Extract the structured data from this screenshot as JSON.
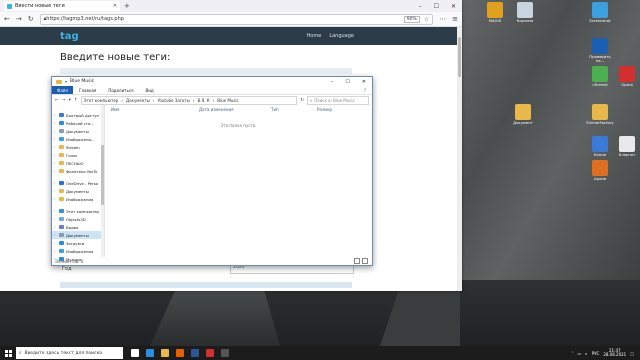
{
  "browser": {
    "tab_title": "Ввести новые теги",
    "url": "https://tagmp3.net/ru/tags.php",
    "zoom": "90%",
    "site_logo": "tag",
    "site_nav": [
      "Home",
      "Language"
    ],
    "page_title": "Введите новые теги:",
    "form_label": "Год",
    "form_value": "2020"
  },
  "explorer": {
    "title": "Blue Music",
    "ribbon": [
      "Файл",
      "Главная",
      "Поделиться",
      "Вид"
    ],
    "breadcrumb": [
      "Этот компьютер",
      "Документы",
      "Youtube Заготы",
      "В.Я. К",
      "Blue Music"
    ],
    "search_placeholder": "Поиск в: Blue Music",
    "nav_items": [
      {
        "label": "Быстрый доступ",
        "icon": "star-icon",
        "color": "#3a7bd5"
      },
      {
        "label": "Рабочий сто...",
        "icon": "desktop-icon",
        "color": "#2a8ee0"
      },
      {
        "label": "Документы",
        "icon": "documents-icon",
        "color": "#8a9bb0"
      },
      {
        "label": "Изображени...",
        "icon": "pictures-icon",
        "color": "#3aa0e0"
      },
      {
        "label": "Stream",
        "icon": "folder-icon",
        "color": "#e8b948"
      },
      {
        "label": "Голос",
        "icon": "folder-icon",
        "color": "#e8b948"
      },
      {
        "label": "ПЕСНЬЮ",
        "icon": "folder-icon",
        "color": "#e8b948"
      },
      {
        "label": "Фонотека YouTu",
        "icon": "folder-icon",
        "color": "#e8b948"
      },
      {
        "label": "OneDrive - Perso",
        "icon": "cloud-icon",
        "color": "#1a73e8"
      },
      {
        "label": "Документы",
        "icon": "folder-icon",
        "color": "#e8b948"
      },
      {
        "label": "Изображения",
        "icon": "folder-icon",
        "color": "#e8b948"
      },
      {
        "label": "Этот компьютер",
        "icon": "computer-icon",
        "color": "#3a8fd8"
      },
      {
        "label": "Objects3D",
        "icon": "objects3d-icon",
        "color": "#7aa6d8"
      },
      {
        "label": "Видео",
        "icon": "video-icon",
        "color": "#6b7bd8"
      },
      {
        "label": "Документы",
        "icon": "documents-icon",
        "color": "#8a9bb0"
      },
      {
        "label": "Загрузки",
        "icon": "downloads-icon",
        "color": "#2a8ee0"
      },
      {
        "label": "Изображения",
        "icon": "pictures-icon",
        "color": "#3aa0e0"
      },
      {
        "label": "Музыка",
        "icon": "music-icon",
        "color": "#2a8ee0"
      }
    ],
    "selected_nav_index": 14,
    "columns": [
      "Имя",
      "Дата изменения",
      "Тип",
      "Размер"
    ],
    "empty_text": "Эта папка пуста.",
    "status": "Элементов: 0"
  },
  "desktop_icons": [
    {
      "label": "MAGIX",
      "color": "#e0a020"
    },
    {
      "label": "Корзина",
      "color": "#c8d4e0"
    },
    {
      "label": "Screenshot",
      "color": "#3aa0e0"
    },
    {
      "label": "Проверить на...",
      "color": "#1a5fb4"
    },
    {
      "label": "uTorrent",
      "color": "#4caf50"
    },
    {
      "label": "Opera",
      "color": "#d32f2f"
    },
    {
      "label": "Документ",
      "color": "#e8b948"
    },
    {
      "label": "FormatFactory",
      "color": "#e8b948"
    },
    {
      "label": "Копия",
      "color": "#3a7bd5"
    },
    {
      "label": "Блокнот",
      "color": "#e8e8e8"
    },
    {
      "label": "Архив",
      "color": "#e07020"
    }
  ],
  "taskbar": {
    "search_placeholder": "Введите здесь текст для поиска",
    "icons": [
      {
        "name": "task-view-icon",
        "color": "#ffffff"
      },
      {
        "name": "edge-icon",
        "color": "#2a8ee0"
      },
      {
        "name": "explorer-icon",
        "color": "#e8b948"
      },
      {
        "name": "firefox-icon",
        "color": "#e66000"
      },
      {
        "name": "word-icon",
        "color": "#2b579a"
      },
      {
        "name": "opera-icon",
        "color": "#d32f2f"
      },
      {
        "name": "obs-icon",
        "color": "#555555"
      }
    ],
    "lang": "РУС",
    "time": "21:47",
    "date": "28.08.2021"
  }
}
